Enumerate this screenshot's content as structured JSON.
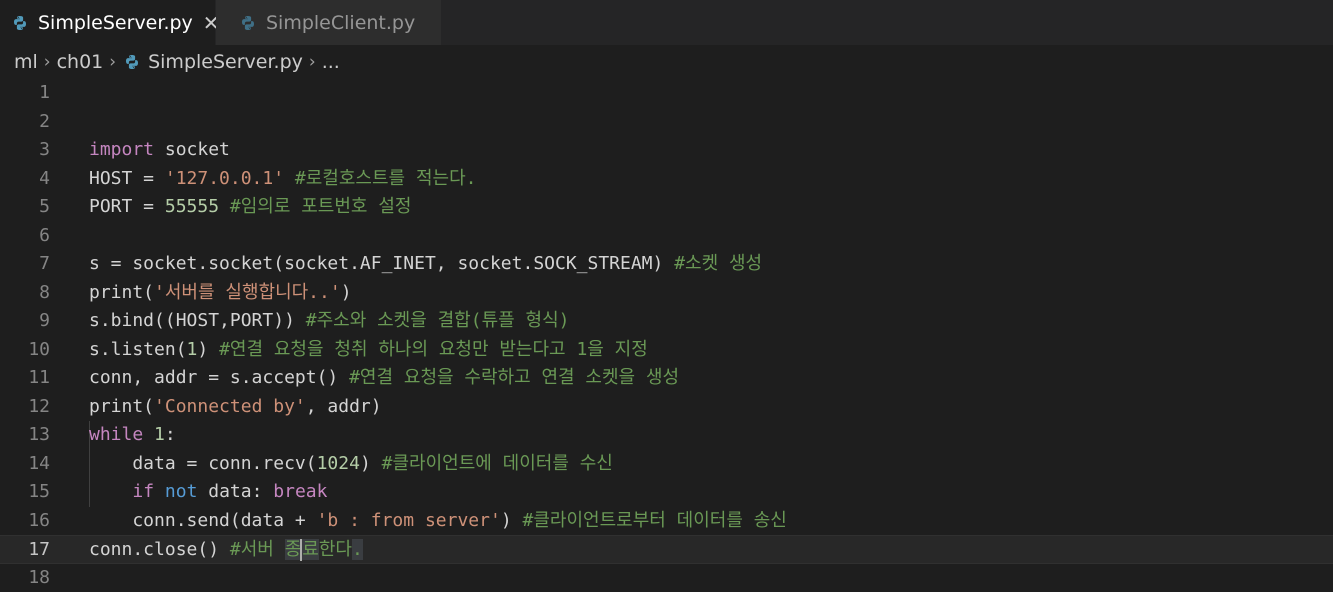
{
  "tabs": [
    {
      "label": "SimpleServer.py",
      "active": true,
      "close_glyph": "✕"
    },
    {
      "label": "SimpleClient.py",
      "active": false
    }
  ],
  "breadcrumb": {
    "parts": [
      "ml",
      "ch01",
      "SimpleServer.py",
      "..."
    ],
    "separator": "›"
  },
  "colors": {
    "keyword": "#c586c0",
    "builtin_keyword": "#569cd6",
    "string": "#ce9178",
    "number": "#b5cea8",
    "comment": "#6a9955",
    "text": "#d4d4d4"
  },
  "icons": {
    "file": "python-icon",
    "close": "close-icon",
    "separator": "chevron-right-icon"
  },
  "editor": {
    "line_numbers": [
      "1",
      "2",
      "3",
      "4",
      "5",
      "6",
      "7",
      "8",
      "9",
      "10",
      "11",
      "12",
      "13",
      "14",
      "15",
      "16",
      "17",
      "18"
    ],
    "current_line": "17",
    "code": {
      "l3_kw": "import",
      "l3_rest": " socket",
      "l4_a": "HOST = ",
      "l4_str": "'127.0.0.1'",
      "l4_cm": " #로컬호스트를 적는다.",
      "l5_a": "PORT = ",
      "l5_num": "55555",
      "l5_cm": " #임의로 포트번호 설정",
      "l7_a": "s = socket.socket(socket.AF_INET, socket.SOCK_STREAM)",
      "l7_cm": " #소켓 생성",
      "l8_a": "print(",
      "l8_str": "'서버를 실행합니다..'",
      "l8_b": ")",
      "l9_a": "s.bind((HOST,PORT))",
      "l9_cm": " #주소와 소켓을 결합(튜플 형식)",
      "l10_a": "s.listen(",
      "l10_num": "1",
      "l10_b": ")",
      "l10_cm": " #연결 요청을 청취 하나의 요청만 받는다고 1을 지정",
      "l11_a": "conn, addr = s.accept()",
      "l11_cm": " #연결 요청을 수락하고 연결 소켓을 생성",
      "l12_a": "print(",
      "l12_str": "'Connected by'",
      "l12_b": ", addr)",
      "l13_kw": "while",
      "l13_sp": " ",
      "l13_num": "1",
      "l13_b": ":",
      "l14_a": "    data = conn.recv(",
      "l14_num": "1024",
      "l14_b": ")",
      "l14_cm": " #클라이언트에 데이터를 수신",
      "l15_ind": "    ",
      "l15_kw": "if",
      "l15_sp": " ",
      "l15_kw2": "not",
      "l15_b": " data: ",
      "l15_kw3": "break",
      "l16_a": "    conn.send(data + ",
      "l16_str": "'b : from server'",
      "l16_b": ")",
      "l16_cm": " #클라이언트로부터 데이터를 송신",
      "l17_a": "conn.close()",
      "l17_cm1": " #서버 ",
      "l17_cm2": "종",
      "l17_cm3": "료",
      "l17_cm4": "한다",
      "l17_cm5": "."
    }
  }
}
